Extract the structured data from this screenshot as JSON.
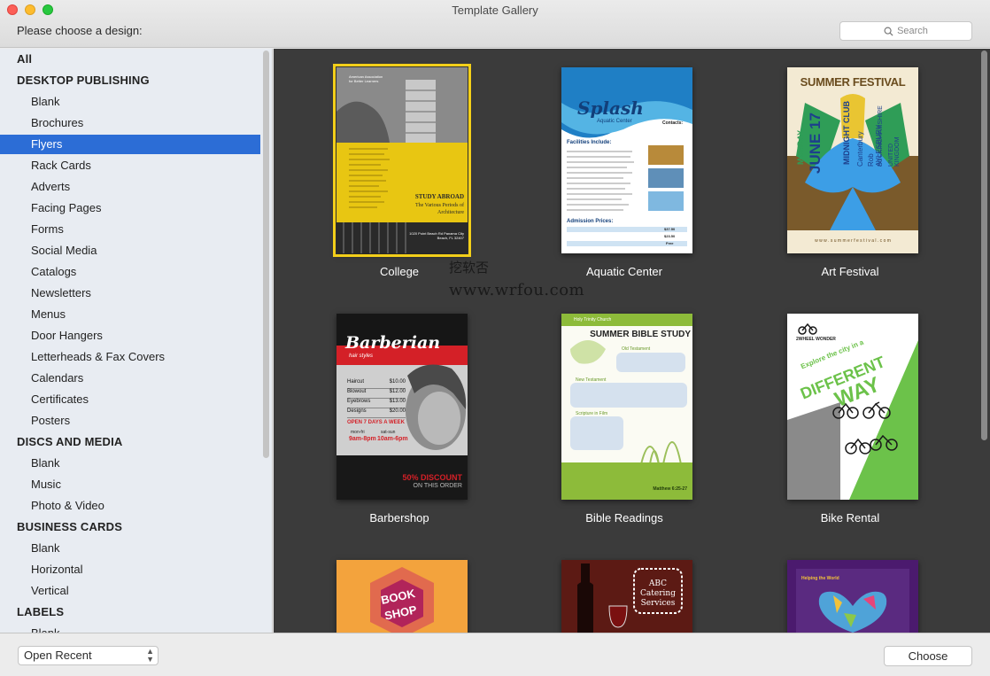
{
  "window": {
    "title": "Template Gallery"
  },
  "header": {
    "prompt": "Please choose a design:",
    "search_placeholder": "Search"
  },
  "sidebar": {
    "items": [
      {
        "label": "All",
        "kind": "header"
      },
      {
        "label": "DESKTOP PUBLISHING",
        "kind": "header"
      },
      {
        "label": "Blank",
        "kind": "sub"
      },
      {
        "label": "Brochures",
        "kind": "sub"
      },
      {
        "label": "Flyers",
        "kind": "sub",
        "selected": true
      },
      {
        "label": "Rack Cards",
        "kind": "sub"
      },
      {
        "label": "Adverts",
        "kind": "sub"
      },
      {
        "label": "Facing Pages",
        "kind": "sub"
      },
      {
        "label": "Forms",
        "kind": "sub"
      },
      {
        "label": "Social Media",
        "kind": "sub"
      },
      {
        "label": "Catalogs",
        "kind": "sub"
      },
      {
        "label": "Newsletters",
        "kind": "sub"
      },
      {
        "label": "Menus",
        "kind": "sub"
      },
      {
        "label": "Door Hangers",
        "kind": "sub"
      },
      {
        "label": "Letterheads & Fax Covers",
        "kind": "sub"
      },
      {
        "label": "Calendars",
        "kind": "sub"
      },
      {
        "label": "Certificates",
        "kind": "sub"
      },
      {
        "label": "Posters",
        "kind": "sub"
      },
      {
        "label": "DISCS AND MEDIA",
        "kind": "header"
      },
      {
        "label": "Blank",
        "kind": "sub"
      },
      {
        "label": "Music",
        "kind": "sub"
      },
      {
        "label": "Photo & Video",
        "kind": "sub"
      },
      {
        "label": "BUSINESS CARDS",
        "kind": "header"
      },
      {
        "label": "Blank",
        "kind": "sub"
      },
      {
        "label": "Horizontal",
        "kind": "sub"
      },
      {
        "label": "Vertical",
        "kind": "sub"
      },
      {
        "label": "LABELS",
        "kind": "header"
      },
      {
        "label": "Blank",
        "kind": "sub"
      }
    ]
  },
  "templates": {
    "college": {
      "caption": "College",
      "org": "American Association for Better Learners",
      "heading": "STUDY ABROAD",
      "subheading": "The Various Periods of Architecture",
      "address": "1020 Point Beach Rd Panama City Beach, FL 32407"
    },
    "aquatic": {
      "caption": "Aquatic Center",
      "logo": "Splash",
      "logo_sub": "Aquatic Center",
      "contacts": "Contacts:",
      "facilities": "Facilities Include:",
      "admission": "Admission Prices:",
      "prices": [
        "$37.50",
        "$23.50",
        "Free"
      ]
    },
    "art": {
      "caption": "Art Festival",
      "title": "SUMMER FESTIVAL",
      "day": "MONDAY",
      "date": "JUNE 17",
      "venue": "MIDNIGHT CLUB",
      "loc1": "Canterbury",
      "loc2": "Rob AYLESBURY",
      "loc3": "BUCKINGHAMSHIRE",
      "loc4": "UNITED KINGDOM",
      "url": "w w w . s u m m e r f e s t i v a l . c o m"
    },
    "barber": {
      "caption": "Barbershop",
      "logo": "Barberian",
      "logo_sub": "hair styles",
      "services": [
        {
          "name": "Haircut",
          "price": "$10.00"
        },
        {
          "name": "Blowout",
          "price": "$12.00"
        },
        {
          "name": "Eyebrows",
          "price": "$13.00"
        },
        {
          "name": "Designs",
          "price": "$20.00"
        }
      ],
      "open": "OPEN 7 DAYS A WEEK",
      "hours_label1": "mon-fri",
      "hours_label2": "sat-sun",
      "hours1": "9am-8pm",
      "hours2": "10am-6pm",
      "discount": "50% DISCOUNT",
      "discount_sub": "ON THIS ORDER"
    },
    "bible": {
      "caption": "Bible Readings",
      "church": "Holy Trinity Church",
      "title": "SUMMER BIBLE STUDY",
      "old": "Old Testament",
      "new": "New Testament",
      "film": "Scripture in Film",
      "verse": "Matthew 6:25-27"
    },
    "bike": {
      "caption": "Bike Rental",
      "brand": "2WHEEL WONDER",
      "line1": "Explore the city in a",
      "line2": "DIFFERENT",
      "line3": "WAY"
    },
    "book": {
      "title1": "BOOK",
      "title2": "SHOP"
    },
    "catering": {
      "line1": "ABC",
      "line2": "Catering",
      "line3": "Services"
    },
    "helping": {
      "title": "Helping the World"
    }
  },
  "watermark": {
    "line1": "挖软否",
    "line2": "www.wrfou.com"
  },
  "footer": {
    "recent_label": "Open Recent",
    "choose_label": "Choose"
  }
}
